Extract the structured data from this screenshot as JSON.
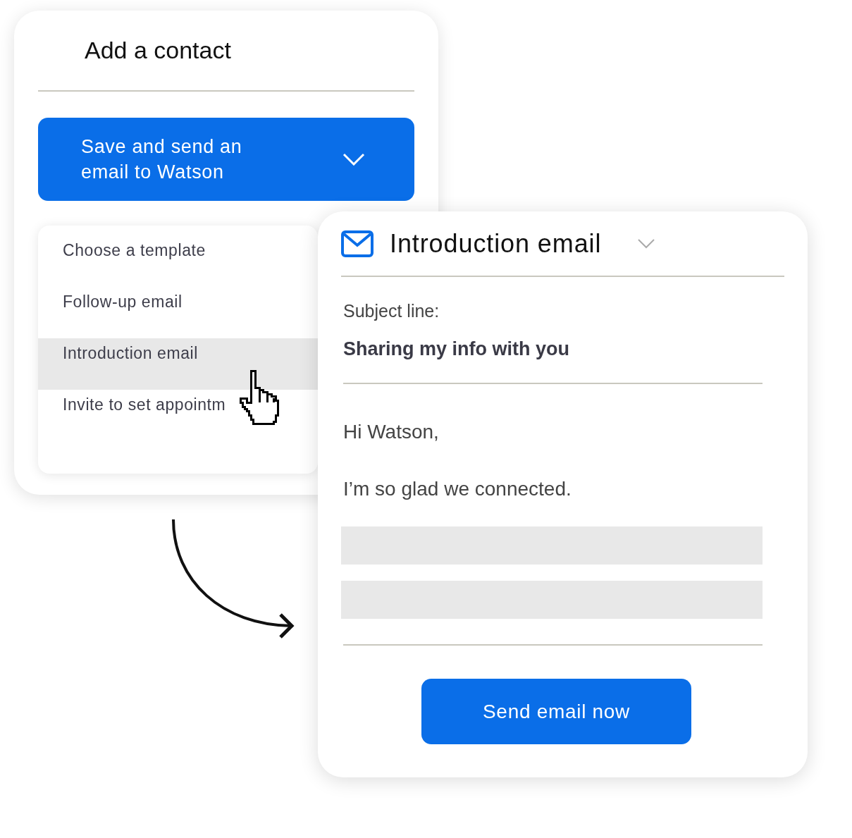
{
  "contact_card": {
    "title": "Add a contact",
    "save_button": {
      "label": "Save and send an email to Watson"
    }
  },
  "template_menu": {
    "items": [
      {
        "label": "Choose a template",
        "selected": false
      },
      {
        "label": "Follow-up email",
        "selected": false
      },
      {
        "label": "Introduction email",
        "selected": true
      },
      {
        "label": "Invite to set appointm",
        "selected": false
      }
    ]
  },
  "email_card": {
    "template": "Introduction email",
    "subject_label": "Subject line:",
    "subject": "Sharing my info with you",
    "body": [
      {
        "kind": "text",
        "text": "Hi Watson,"
      },
      {
        "kind": "text",
        "text": "I’m so glad we connected."
      },
      {
        "kind": "placeholder_bar"
      },
      {
        "kind": "placeholder_bar"
      }
    ],
    "send_button": "Send email now"
  }
}
